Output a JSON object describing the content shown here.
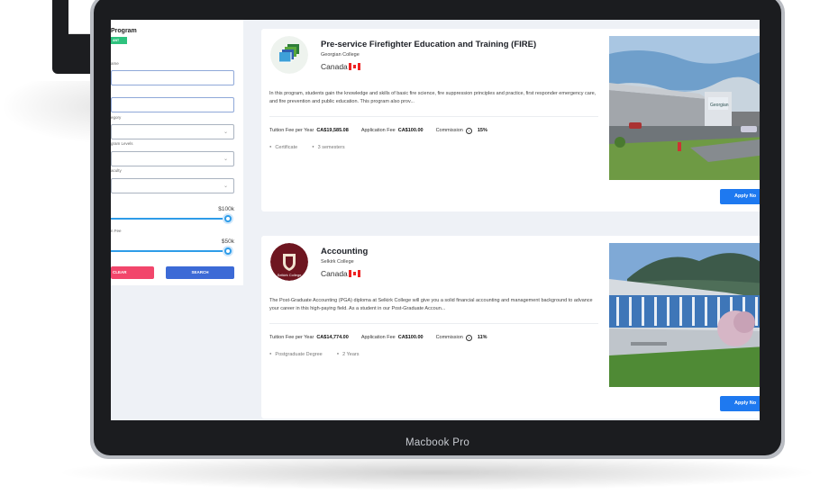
{
  "device": {
    "label": "Macbook Pro"
  },
  "sidebar": {
    "title": "Program",
    "badge": "ANT",
    "labels": [
      "ame",
      "",
      "egory",
      "gram Levels",
      "aculty",
      "",
      "n Fee"
    ],
    "tuition_max": "$100k",
    "fee_max": "$50k",
    "clear_label": "CLEAR",
    "search_label": "SEARCH"
  },
  "programs": [
    {
      "title": "Pre-service Firefighter Education and Training (FIRE)",
      "school": "Georgian College",
      "country": "Canada",
      "description": "In this program, students gain the knowledge and skills of basic fire science, fire suppression principles and practice, first responder emergency care, and fire prevention and public education. This program also prov...",
      "tuition_label": "Tuition Fee per Year",
      "tuition": "CA$19,585.08",
      "app_fee_label": "Application Fee",
      "app_fee": "CA$100.00",
      "commission_label": "Commission",
      "commission": "15%",
      "level": "Certificate",
      "duration": "3 semesters",
      "apply_label": "Apply No"
    },
    {
      "title": "Accounting",
      "school": "Selkirk College",
      "country": "Canada",
      "description": "The Post-Graduate Accounting (PGA) diploma at Selkirk College will give you a solid financial accounting and management background to advance your career in this high-paying field.  As a student in our Post-Graduate Accoun...",
      "tuition_label": "Tuition Fee per Year",
      "tuition": "CA$14,774.00",
      "app_fee_label": "Application Fee",
      "app_fee": "CA$100.00",
      "commission_label": "Commission",
      "commission": "11%",
      "level": "Postgraduate Degree",
      "duration": "2 Years",
      "apply_label": "Apply No"
    }
  ],
  "logos": {
    "selkirk_text": "Selkirk College"
  },
  "colors": {
    "accent": "#1e79f0",
    "clear": "#f2466b",
    "search": "#3c6ad6",
    "slider": "#2e9ce8",
    "badge": "#2ec27e"
  }
}
